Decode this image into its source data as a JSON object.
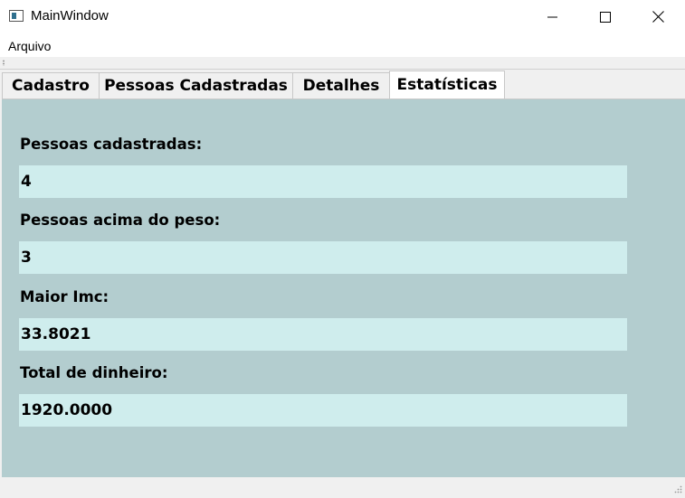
{
  "window": {
    "title": "MainWindow"
  },
  "menubar": {
    "items": [
      {
        "label": "Arquivo"
      }
    ]
  },
  "tabs": [
    {
      "label": "Cadastro",
      "active": false
    },
    {
      "label": "Pessoas Cadastradas",
      "active": false
    },
    {
      "label": "Detalhes",
      "active": false
    },
    {
      "label": "Estatísticas",
      "active": true
    }
  ],
  "stats": {
    "registered_label": "Pessoas cadastradas:",
    "registered_value": "4",
    "overweight_label": "Pessoas acima do peso:",
    "overweight_value": "3",
    "max_imc_label": "Maior Imc:",
    "max_imc_value": "33.8021",
    "total_money_label": "Total de dinheiro:",
    "total_money_value": "1920.0000"
  },
  "colors": {
    "panel_background": "#b3cdcf",
    "field_background": "#cfeded"
  }
}
